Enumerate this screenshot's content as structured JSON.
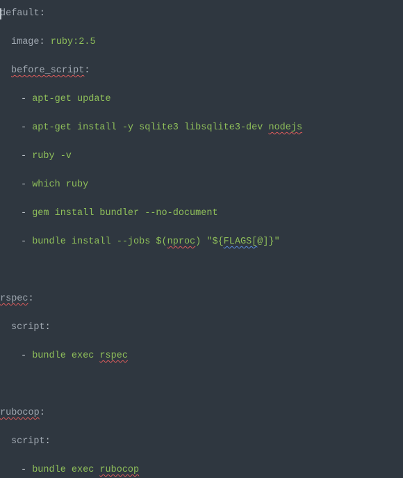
{
  "code": {
    "default_key": "default",
    "image_key": "image",
    "image_val": "ruby:2.5",
    "before_script_key": "before_script",
    "bs_items": {
      "l1": "apt-get update",
      "l2a": "apt-get install -y sqlite3 libsqlite3-dev ",
      "l2b": "nodejs",
      "l3": "ruby -v",
      "l4": "which ruby",
      "l5": "gem install bundler --no-document",
      "l6a": "bundle install --jobs $(",
      "l6b": "nproc",
      "l6c": ") \"${",
      "l6d": "FLAGS[",
      "l6e": "@]}\""
    },
    "rspec_key": "rspec",
    "script_key": "script",
    "rspec_item_a": "bundle exec ",
    "rspec_item_b": "rspec",
    "rubocop_key": "rubocop",
    "rubocop_item_a": "bundle exec ",
    "rubocop_item_b": "rubocop",
    "colon": ":",
    "dash": "- "
  }
}
